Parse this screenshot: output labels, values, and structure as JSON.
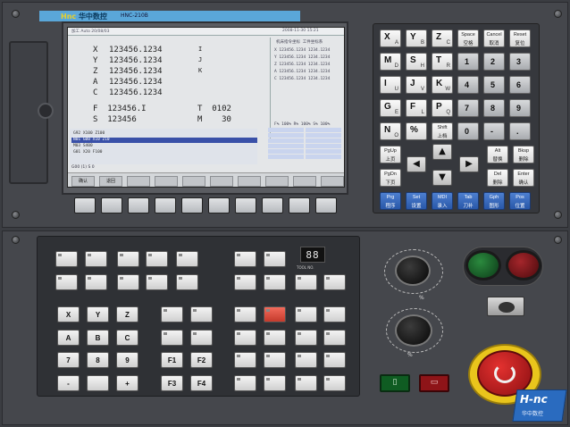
{
  "header": {
    "brand_hl": "Hnc",
    "brand_rest": "华中数控",
    "model": "HNC-210B"
  },
  "screen": {
    "top_bar_left": "加工 Auto   20/08/03",
    "top_bar_right": "2008-11-30  15:21",
    "coords": [
      {
        "axis": "X",
        "value": "123456.1234",
        "tag": "I"
      },
      {
        "axis": "Y",
        "value": "123456.1234",
        "tag": "J"
      },
      {
        "axis": "Z",
        "value": "123456.1234",
        "tag": "K"
      },
      {
        "axis": "A",
        "value": "123456.1234",
        "tag": ""
      },
      {
        "axis": "C",
        "value": "123456.1234",
        "tag": ""
      }
    ],
    "feed": "F  123456.I",
    "spindle": "S  123456",
    "tool_label": "T  0102",
    "m_label": "M    30",
    "right_panel_title": "机床指令坐标    工件坐标系",
    "right_rows": [
      "X 123456.1234  1234.1234",
      "Y 123456.1234  1234.1234",
      "Z 123456.1234  1234.1234",
      "A 123456.1234  1234.1234",
      "C 123456.1234  1234.1234"
    ],
    "override": "F% 100%  R% 100%  S% 100%",
    "prog_lines": [
      "G92 X100 Z100",
      "N01 G00 X10 Z10",
      "M03 S400",
      "G01 X20 F100"
    ],
    "status_left": "G00 (1) S 0",
    "soft_keys": [
      "确认",
      "退回",
      "",
      "",
      "",
      "",
      "",
      "",
      "",
      ""
    ]
  },
  "keypad": {
    "keys": [
      {
        "main": "X",
        "sub": "A"
      },
      {
        "main": "Y",
        "sub": "B"
      },
      {
        "main": "Z",
        "sub": "C"
      },
      {
        "t1": "Space",
        "t2": "空格"
      },
      {
        "t1": "Cancel",
        "t2": "取消"
      },
      {
        "t1": "Reset",
        "t2": "复位"
      },
      {
        "main": "M",
        "sub": "D"
      },
      {
        "main": "S",
        "sub": "H"
      },
      {
        "main": "T",
        "sub": "R"
      },
      {
        "main": "1",
        "sub": ""
      },
      {
        "main": "2",
        "sub": ""
      },
      {
        "main": "3",
        "sub": ""
      },
      {
        "main": "I",
        "sub": "U"
      },
      {
        "main": "J",
        "sub": "V"
      },
      {
        "main": "K",
        "sub": "W"
      },
      {
        "main": "4",
        "sub": ""
      },
      {
        "main": "5",
        "sub": ""
      },
      {
        "main": "6",
        "sub": ""
      },
      {
        "main": "G",
        "sub": "E"
      },
      {
        "main": "F",
        "sub": "L"
      },
      {
        "main": "P",
        "sub": "Q"
      },
      {
        "main": "7",
        "sub": ""
      },
      {
        "main": "8",
        "sub": ""
      },
      {
        "main": "9",
        "sub": ""
      },
      {
        "main": "N",
        "sub": "O"
      },
      {
        "main": "%",
        "sub": ""
      },
      {
        "t1": "Shift",
        "t2": "上档"
      },
      {
        "main": "0",
        "sub": ""
      },
      {
        "main": "-",
        "sub": ""
      },
      {
        "main": ".",
        "sub": ""
      }
    ],
    "side_keys": [
      {
        "t1": "PgUp",
        "t2": "上页"
      },
      {
        "t1": "Alt",
        "t2": "替换"
      },
      {
        "t1": "Bksp",
        "t2": "删除"
      },
      {
        "t1": "PgDn",
        "t2": "下页"
      },
      {
        "t1": "Del",
        "t2": "删除"
      },
      {
        "t1": "Enter",
        "t2": "确认"
      }
    ],
    "blue_keys": [
      {
        "t1": "Prg",
        "t2": "程序"
      },
      {
        "t1": "Set",
        "t2": "设置"
      },
      {
        "t1": "MDI",
        "t2": "录入"
      },
      {
        "t1": "Tab",
        "t2": "刀补"
      },
      {
        "t1": "Gph",
        "t2": "图形"
      },
      {
        "t1": "Pos",
        "t2": "位置"
      }
    ]
  },
  "operator": {
    "xyz": [
      "X",
      "Y",
      "Z"
    ],
    "abc": [
      "A",
      "B",
      "C"
    ],
    "num": [
      "7",
      "8",
      "9"
    ],
    "pm": [
      "-",
      "+"
    ],
    "fkeys": [
      "F1",
      "F2",
      "F3",
      "F4"
    ],
    "seg_value": "88",
    "seg_caption": "TOOL NO.",
    "feed_label": "%",
    "spindle_label": "%"
  }
}
